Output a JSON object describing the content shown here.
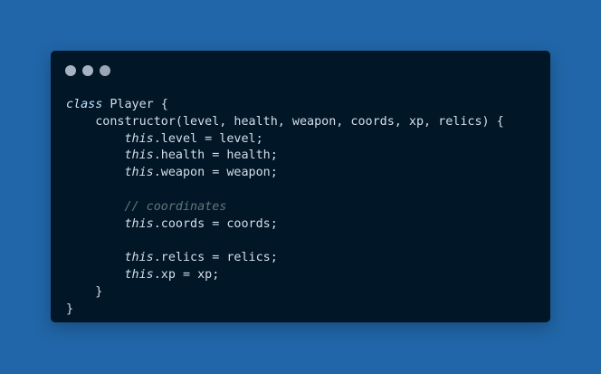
{
  "window": {
    "title_dots": [
      "close-dot",
      "minimize-dot",
      "maximize-dot"
    ],
    "colors": {
      "page_background": "#2166a8",
      "editor_background": "#011627",
      "dot_color": "#a7b3c2",
      "text": "#d6deeb",
      "comment": "#637777"
    }
  },
  "code": {
    "line1_kw": "class",
    "line1_rest": " Player {",
    "line2": "    constructor(level, health, weapon, coords, xp, relics) {",
    "line3_indent": "        ",
    "line3_this": "this",
    "line3_rest": ".level = level;",
    "line4_indent": "        ",
    "line4_this": "this",
    "line4_rest": ".health = health;",
    "line5_indent": "        ",
    "line5_this": "this",
    "line5_rest": ".weapon = weapon;",
    "line6": "",
    "line7_indent": "        ",
    "line7_comment": "// coordinates",
    "line8_indent": "        ",
    "line8_this": "this",
    "line8_rest": ".coords = coords;",
    "line9": "",
    "line10_indent": "        ",
    "line10_this": "this",
    "line10_rest": ".relics = relics;",
    "line11_indent": "        ",
    "line11_this": "this",
    "line11_rest": ".xp = xp;",
    "line12": "    }",
    "line13": "}"
  }
}
